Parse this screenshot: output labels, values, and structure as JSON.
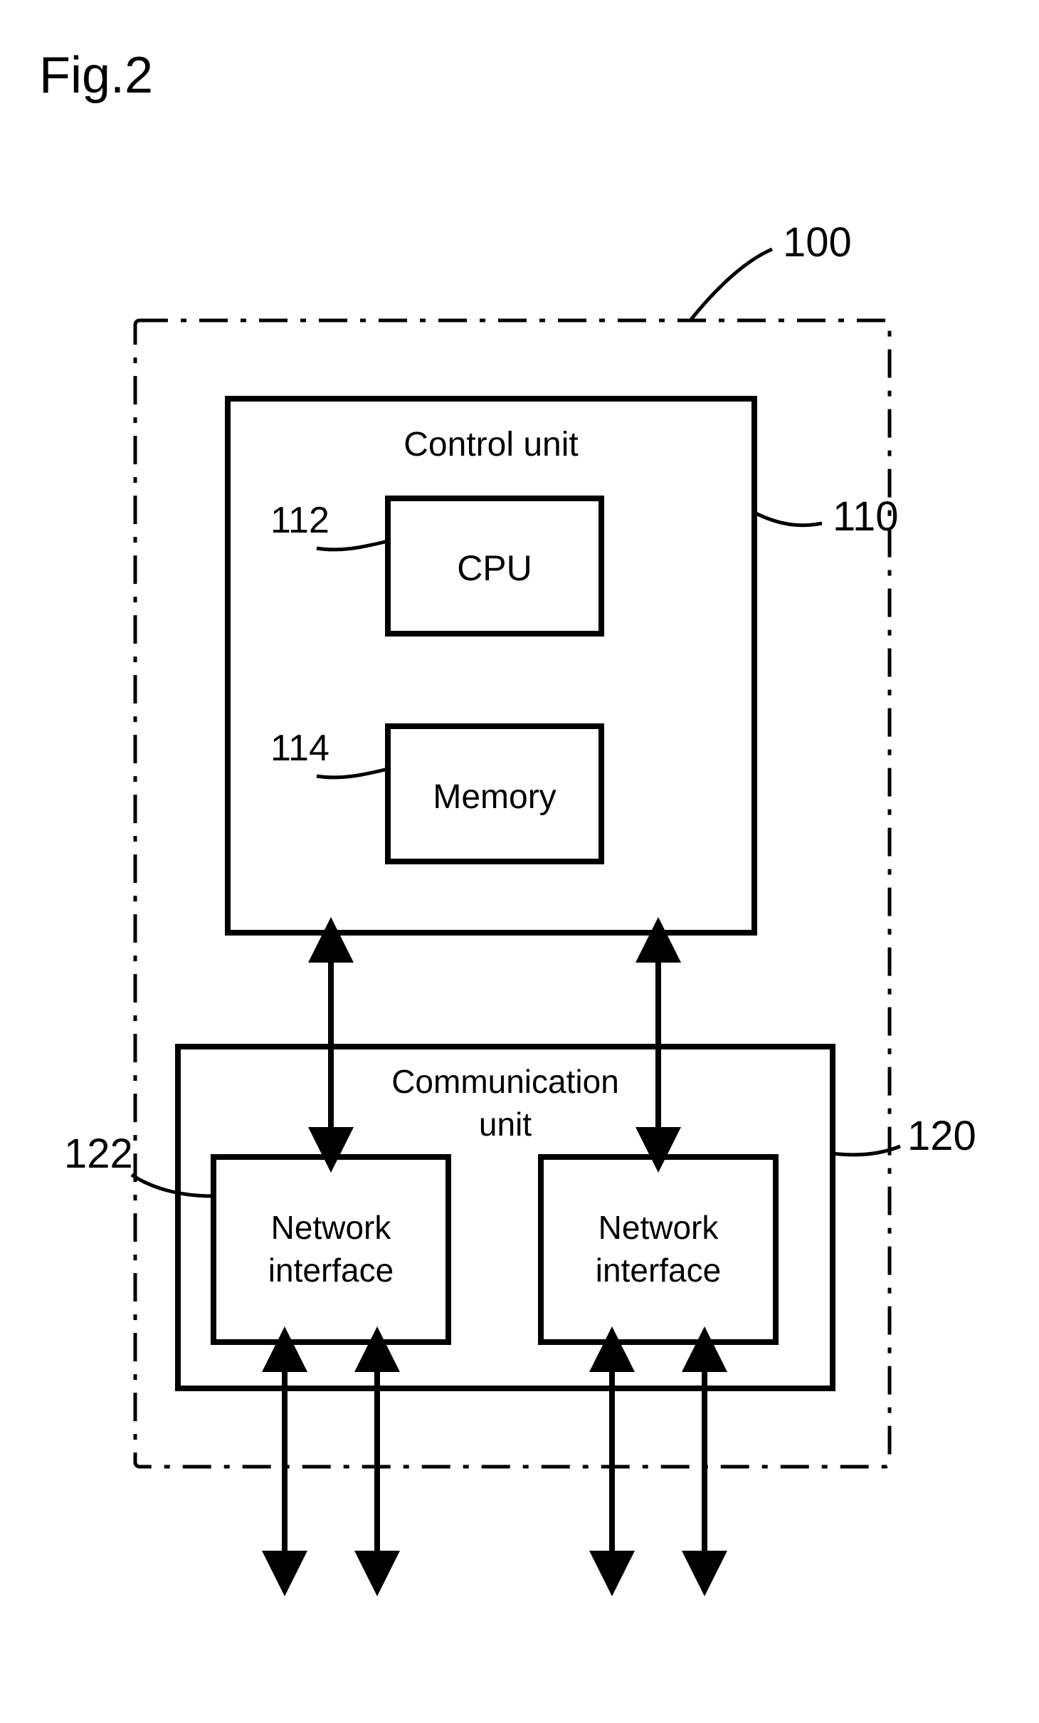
{
  "figure": {
    "caption": "Fig.2",
    "ref_numbers": {
      "system": "100",
      "control_unit": "110",
      "cpu": "112",
      "memory": "114",
      "comm_unit": "120",
      "net_if_left": "122"
    },
    "blocks": {
      "control_unit": "Control unit",
      "cpu": "CPU",
      "memory": "Memory",
      "comm_unit_line1": "Communication",
      "comm_unit_line2": "unit",
      "net_if_line1": "Network",
      "net_if_line2": "interface"
    }
  }
}
